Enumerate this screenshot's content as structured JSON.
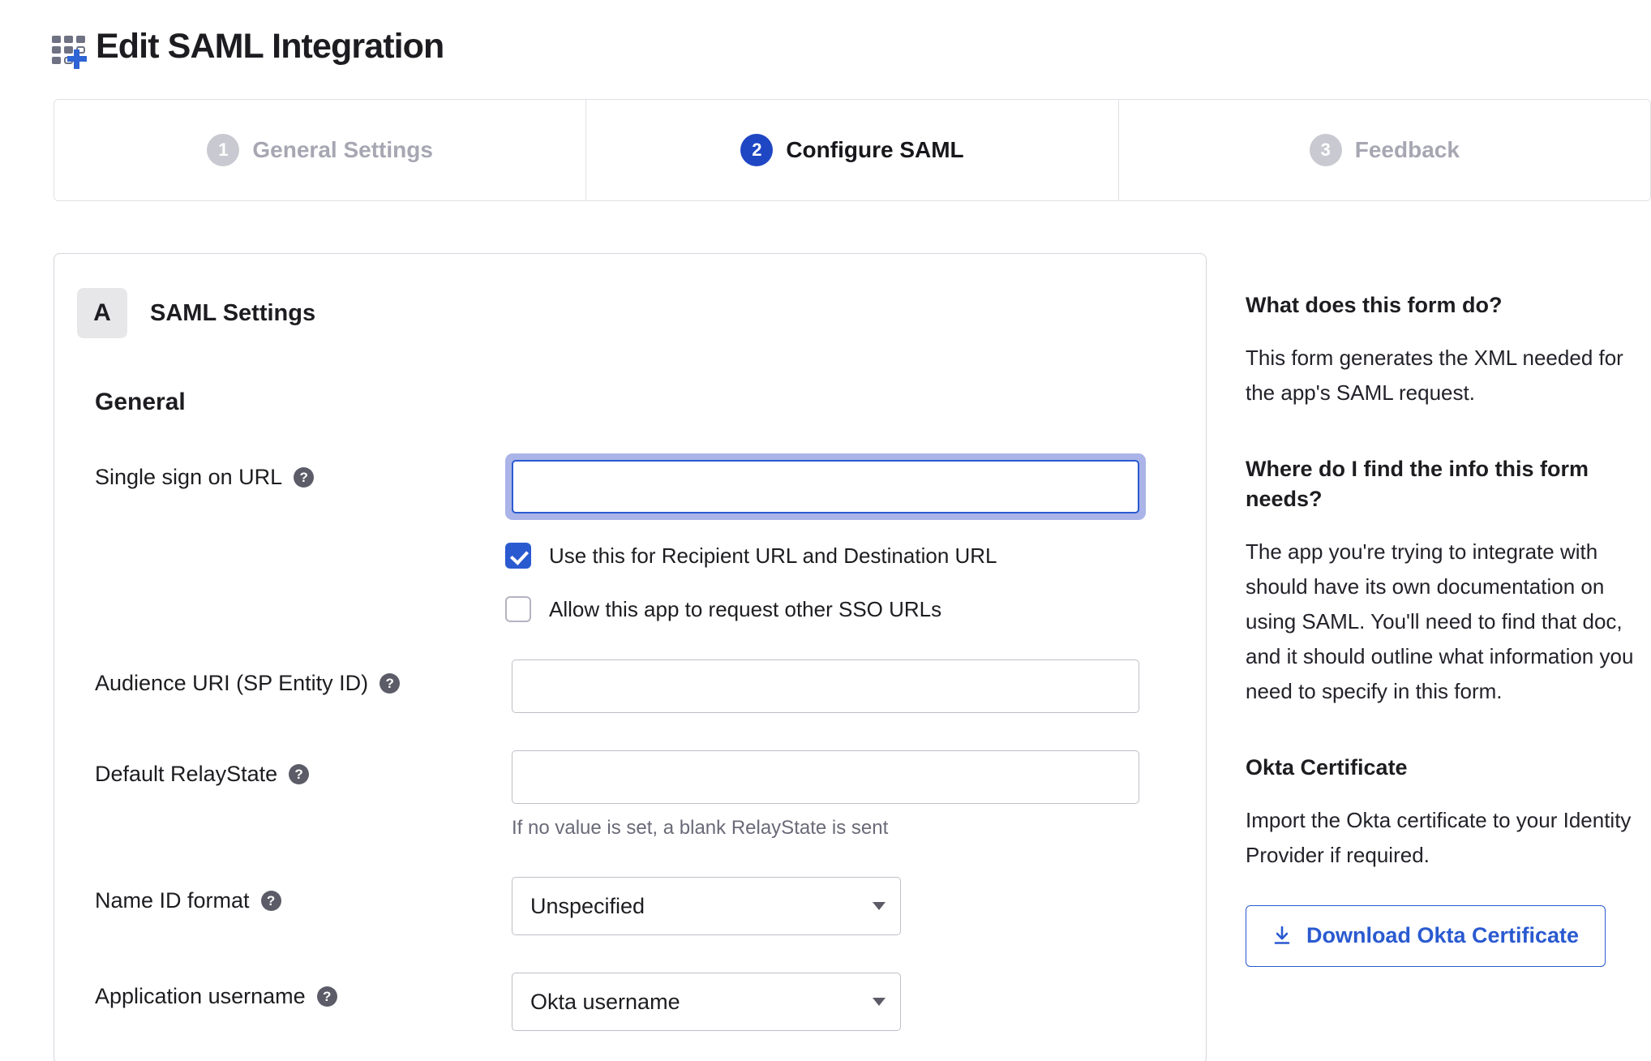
{
  "header": {
    "title": "Edit SAML Integration",
    "icon": "app-add-grid-icon"
  },
  "tabs": [
    {
      "number": "1",
      "label": "General Settings",
      "active": false
    },
    {
      "number": "2",
      "label": "Configure SAML",
      "active": true
    },
    {
      "number": "3",
      "label": "Feedback",
      "active": false
    }
  ],
  "form": {
    "section_letter": "A",
    "section_title": "SAML Settings",
    "group_title": "General",
    "fields": {
      "sso_url": {
        "label": "Single sign on URL",
        "help": "?",
        "value": "",
        "placeholder": "",
        "focused": true
      },
      "recipient_checkbox": {
        "label": "Use this for Recipient URL and Destination URL",
        "checked": true
      },
      "other_sso_checkbox": {
        "label": "Allow this app to request other SSO URLs",
        "checked": false
      },
      "audience_uri": {
        "label": "Audience URI (SP Entity ID)",
        "help": "?",
        "value": "",
        "placeholder": ""
      },
      "default_relaystate": {
        "label": "Default RelayState",
        "help": "?",
        "value": "",
        "placeholder": "",
        "helper_text": "If no value is set, a blank RelayState is sent"
      },
      "name_id_format": {
        "label": "Name ID format",
        "help": "?",
        "selected": "Unspecified"
      },
      "application_username": {
        "label": "Application username",
        "help": "?",
        "selected": "Okta username"
      }
    }
  },
  "sidebar": {
    "what_heading": "What does this form do?",
    "what_body": "This form generates the XML needed for the app's SAML request.",
    "where_heading": "Where do I find the info this form needs?",
    "where_body": "The app you're trying to integrate with should have its own documentation on using SAML. You'll need to find that doc, and it should outline what information you need to specify in this form.",
    "cert_heading": "Okta Certificate",
    "cert_body": "Import the Okta certificate to your Identity Provider if required.",
    "download_label": "Download Okta Certificate"
  },
  "colors": {
    "accent_blue": "#2a5ad0",
    "badge_blue": "#1f47c4",
    "focus_ring": "#aab4e8",
    "inactive_gray": "#c9c9d1",
    "text_dark": "#1d1d21"
  }
}
